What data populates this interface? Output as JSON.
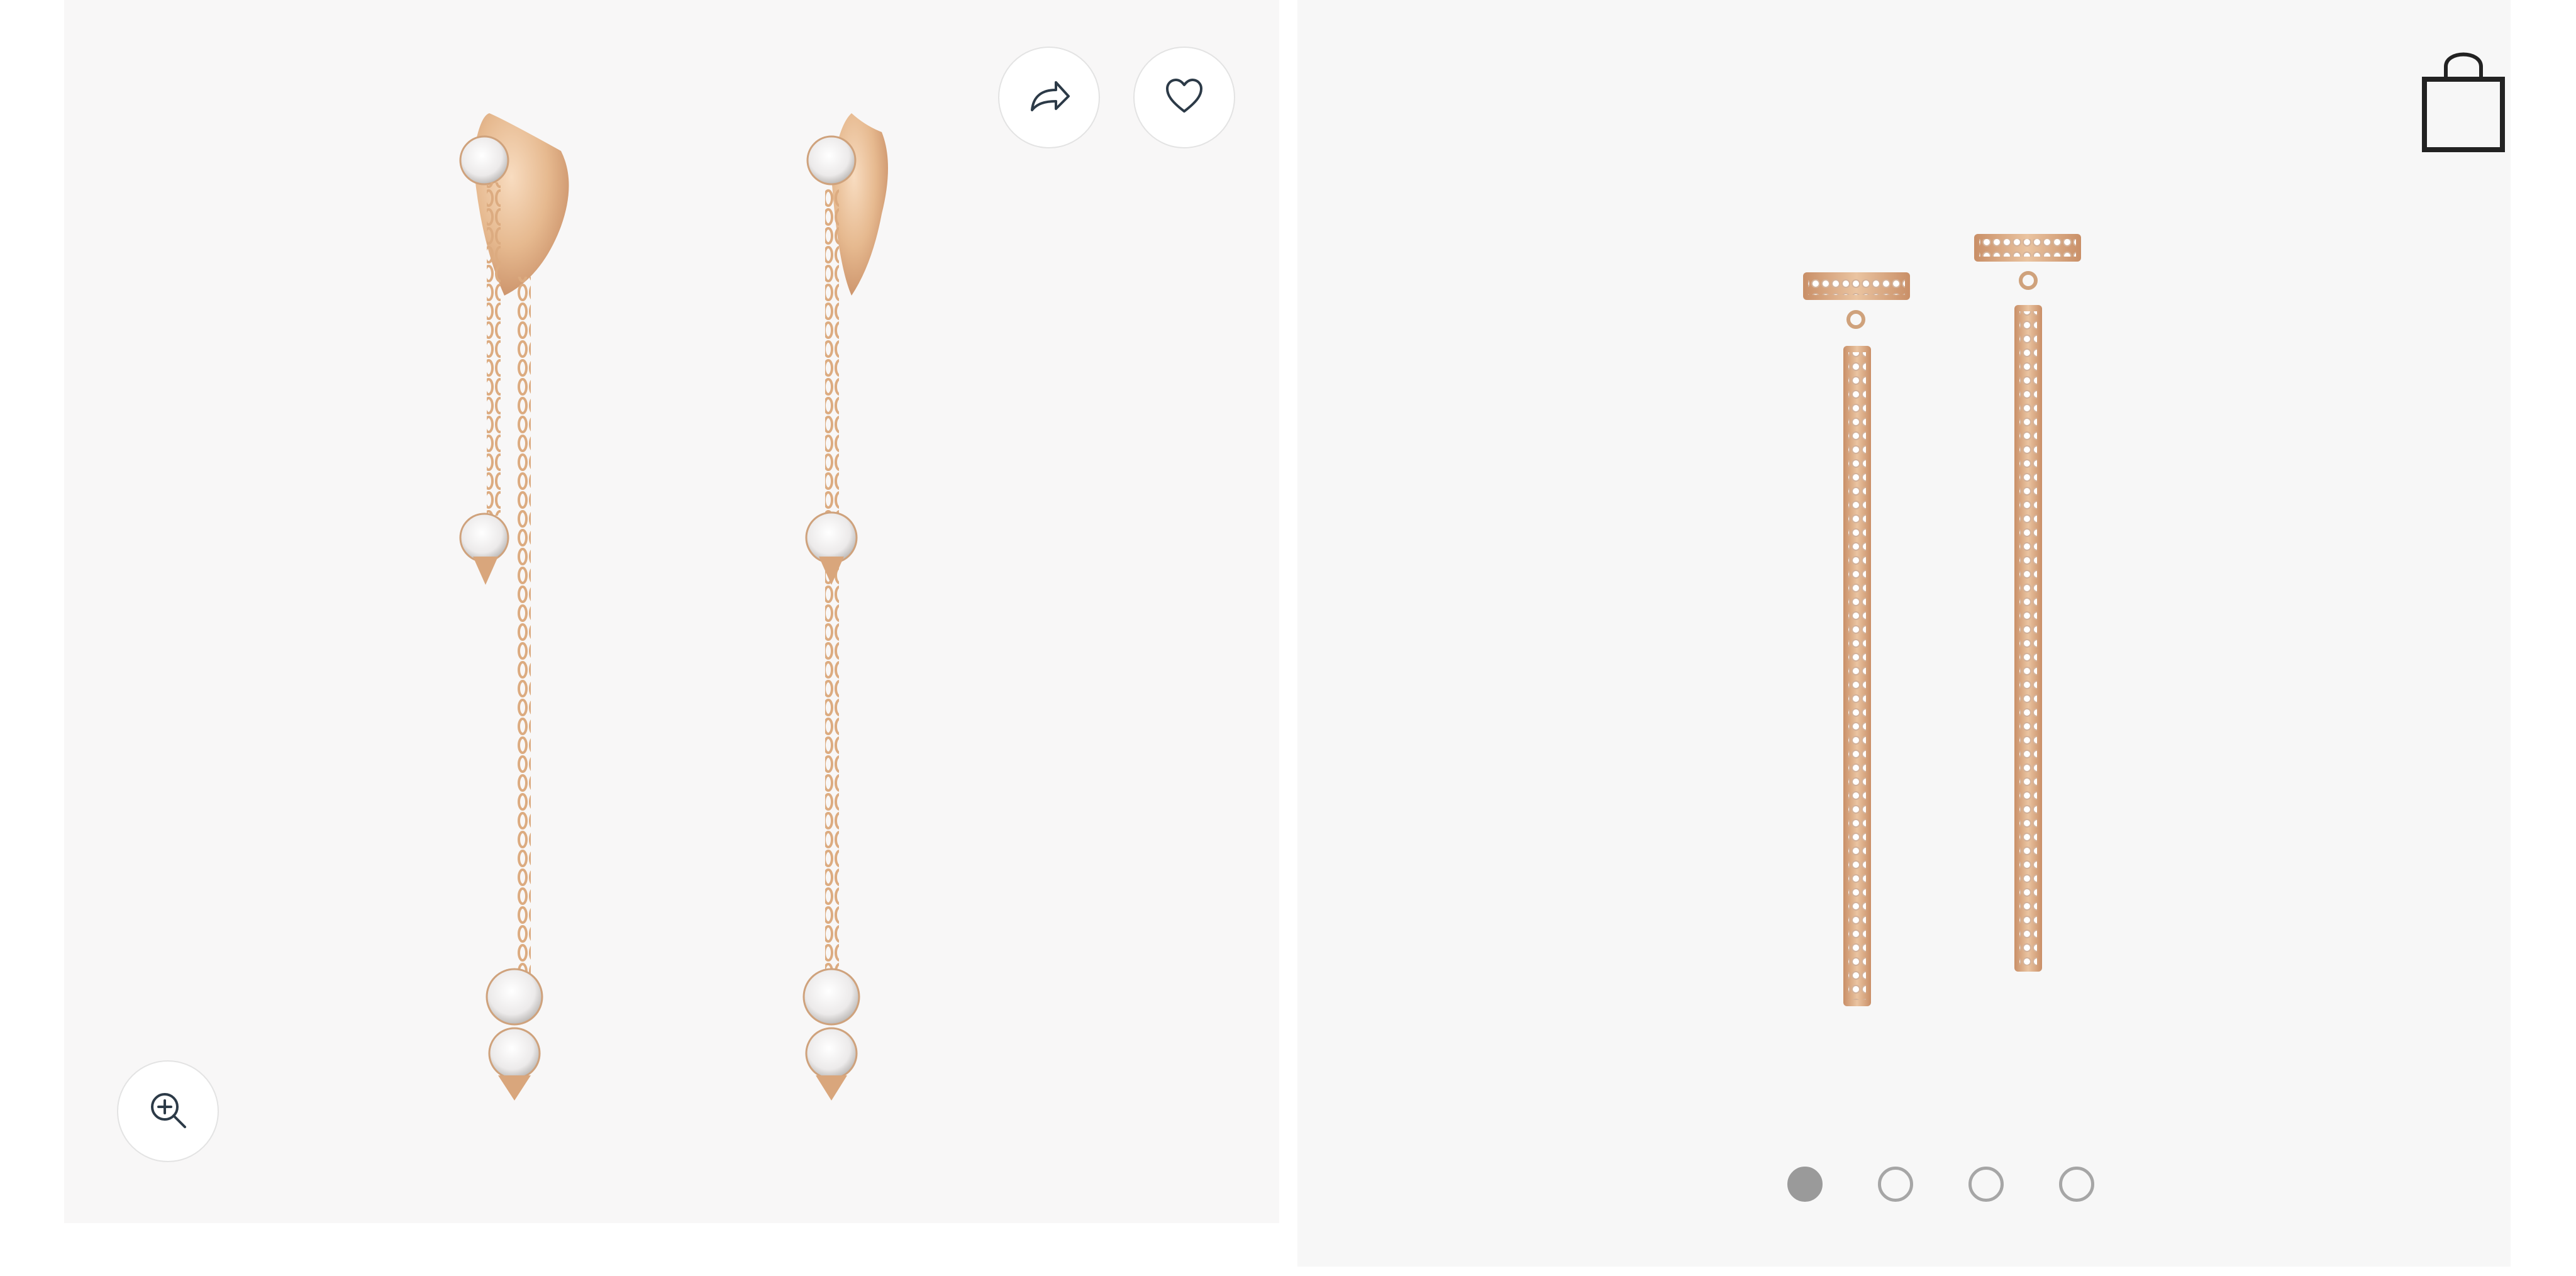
{
  "product_gallery": {
    "actions": {
      "share_icon": "share-arrow-icon",
      "wishlist_icon": "heart-icon",
      "zoom_icon": "zoom-in-icon",
      "bag_icon": "shopping-bag-icon"
    },
    "images": [
      {
        "subject": "rose-gold-diamond-chain-drop-earrings",
        "active": true
      },
      {
        "subject": "rose-gold-pave-diamond-bar-earrings",
        "active": false
      }
    ],
    "carousel": {
      "total": 4,
      "active_index": 0
    }
  },
  "colors": {
    "panel_background": "#f8f7f7",
    "rose_gold": "#e6b98f",
    "rose_gold_dark": "#c98f67",
    "icon_stroke": "#2c3a47",
    "dot_inactive": "#a6a6a6",
    "dot_active": "#9a9a9a"
  }
}
